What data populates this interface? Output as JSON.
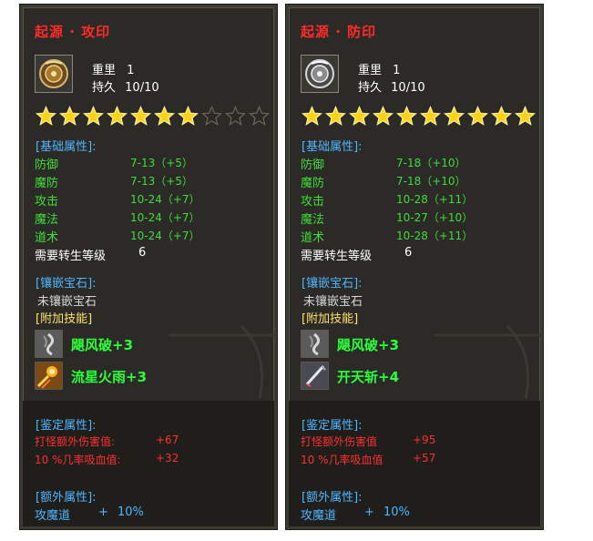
{
  "panels": [
    {
      "title": "起源 · 攻印",
      "weight_label": "重里",
      "weight_value": "1",
      "durability_label": "持久",
      "durability_value": "10/10",
      "stars_filled": 7,
      "stars_total": 10,
      "base_label": "[基础属性]:",
      "attrs": [
        {
          "k": "防御",
          "v": "7-13（+5）"
        },
        {
          "k": "魔防",
          "v": "7-13（+5）"
        },
        {
          "k": "攻击",
          "v": "10-24（+7）"
        },
        {
          "k": "魔法",
          "v": "10-24（+7）"
        },
        {
          "k": "道术",
          "v": "10-24（+7）"
        }
      ],
      "req_label": "需要转生等级",
      "req_value": "6",
      "gem_label": "[镶嵌宝石]:",
      "gem_text": "未镶嵌宝石",
      "skill_label": "[附加技能]",
      "skills": [
        {
          "name": "飓风破+3",
          "icon": "wind-blade-icon"
        },
        {
          "name": "流星火雨+3",
          "icon": "meteor-fire-icon"
        }
      ],
      "appraise_label": "[鉴定属性]:",
      "appraise": [
        {
          "k": "打怪额外伤害值:",
          "v": "+67"
        },
        {
          "k": "10 %几率吸血值:",
          "v": "+32"
        }
      ],
      "extra_label": "[额外属性]:",
      "extra": {
        "k": "攻魔道",
        "v1": "+",
        "v2": "10%"
      }
    },
    {
      "title": "起源 · 防印",
      "weight_label": "重里",
      "weight_value": "1",
      "durability_label": "持久",
      "durability_value": "10/10",
      "stars_filled": 10,
      "stars_total": 10,
      "base_label": "[基础属性]:",
      "attrs": [
        {
          "k": "防御",
          "v": "7-18（+10）"
        },
        {
          "k": "魔防",
          "v": "7-18（+10）"
        },
        {
          "k": "攻击",
          "v": "10-28（+11）"
        },
        {
          "k": "魔法",
          "v": "10-27（+10）"
        },
        {
          "k": "道术",
          "v": "10-28（+11）"
        }
      ],
      "req_label": "需要转生等级",
      "req_value": "6",
      "gem_label": "[镶嵌宝石]:",
      "gem_text": "未镶嵌宝石",
      "skill_label": "[附加技能]",
      "skills": [
        {
          "name": "飓风破+3",
          "icon": "wind-blade-icon"
        },
        {
          "name": "开天斩+4",
          "icon": "sky-slash-icon"
        }
      ],
      "appraise_label": "[鉴定属性]:",
      "appraise": [
        {
          "k": "打怪额外伤害值",
          "v": "+95"
        },
        {
          "k": "10 %几率吸血值",
          "v": "+57"
        }
      ],
      "extra_label": "[额外属性]:",
      "extra": {
        "k": "攻魔道",
        "v1": "+",
        "v2": "10%"
      }
    }
  ],
  "colors": {
    "title": "#ff2a2a",
    "section": "#4fb5ff",
    "attr": "#3fdc3a",
    "skill_label": "#ffe36a",
    "skill_name": "#2aff3a",
    "appraise": "#ff2f2f",
    "star_on": "#ffd21a",
    "star_off": "#6b6858"
  }
}
